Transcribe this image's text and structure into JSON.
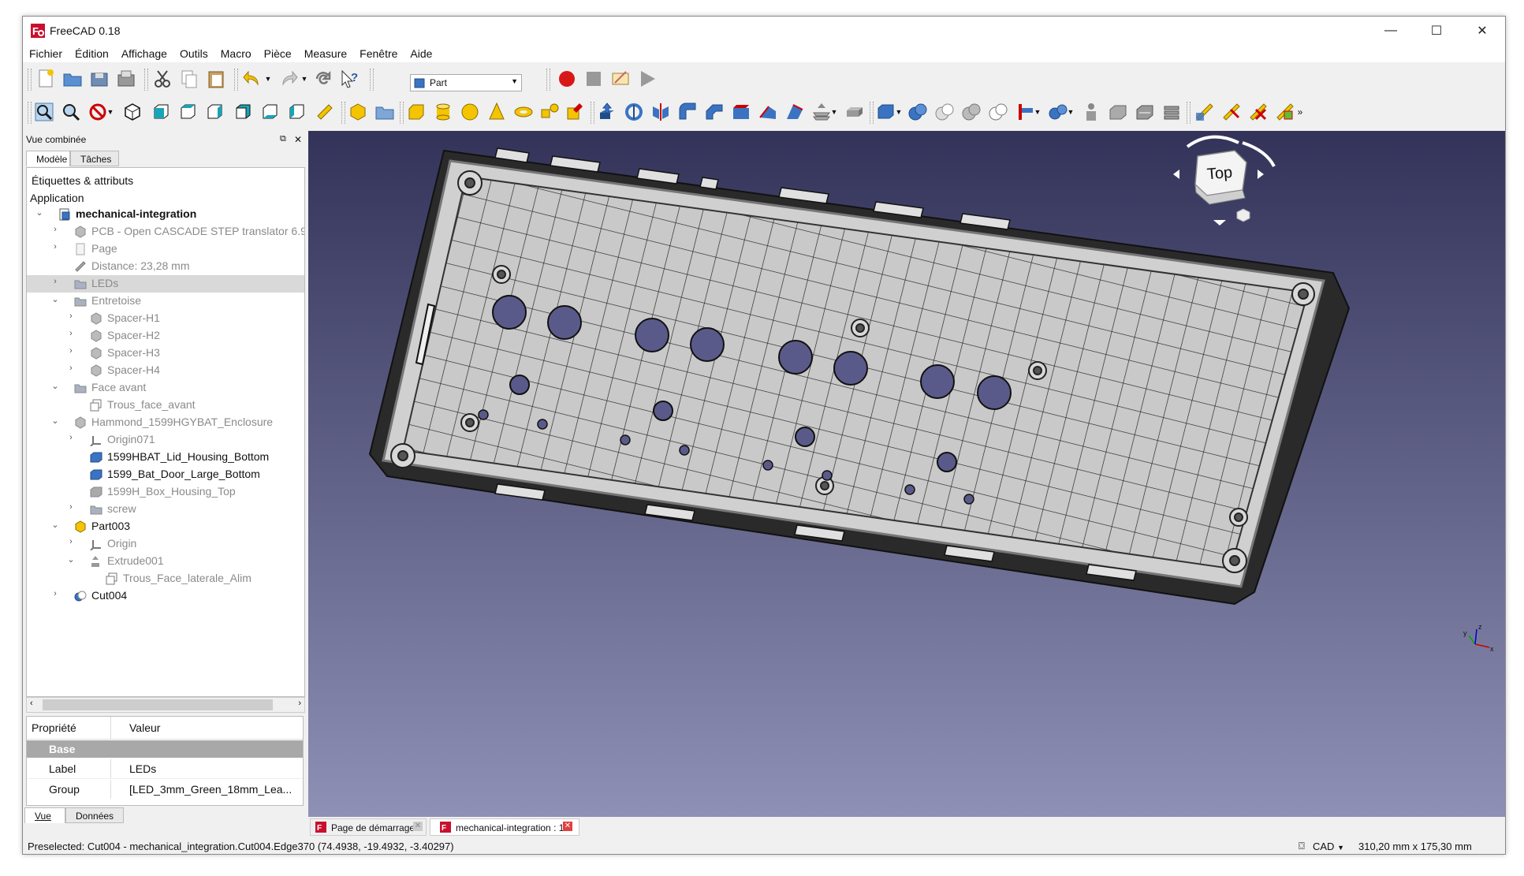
{
  "window": {
    "title": "FreeCAD 0.18",
    "controls": {
      "minimize": "—",
      "maximize": "☐",
      "close": "✕"
    }
  },
  "menu": [
    "Fichier",
    "Édition",
    "Affichage",
    "Outils",
    "Macro",
    "Pièce",
    "Measure",
    "Fenêtre",
    "Aide"
  ],
  "toolbar": {
    "workbench": "Part"
  },
  "panel": {
    "title": "Vue combinée",
    "tabs": [
      "Modèle",
      "Tâches"
    ],
    "tree_header": "Étiquettes & attributs",
    "tree": [
      {
        "label": "Application",
        "depth": -1,
        "style": "normal",
        "twisty": "",
        "icon": ""
      },
      {
        "label": "mechanical-integration",
        "depth": 0,
        "style": "bold",
        "twisty": "open",
        "icon": "document-icon"
      },
      {
        "label": "PCB - Open CASCADE STEP translator 6.9",
        "depth": 1,
        "style": "grey",
        "twisty": "closed",
        "icon": "part-icon"
      },
      {
        "label": "Page",
        "depth": 1,
        "style": "grey",
        "twisty": "closed",
        "icon": "page-icon"
      },
      {
        "label": "Distance: 23,28 mm",
        "depth": 1,
        "style": "grey",
        "twisty": "",
        "icon": "measure-icon"
      },
      {
        "label": "LEDs",
        "depth": 1,
        "style": "grey",
        "twisty": "closed",
        "icon": "folder-icon",
        "selected": true
      },
      {
        "label": "Entretoise",
        "depth": 1,
        "style": "grey",
        "twisty": "open",
        "icon": "folder-icon"
      },
      {
        "label": "Spacer-H1",
        "depth": 2,
        "style": "grey",
        "twisty": "closed",
        "icon": "part-icon"
      },
      {
        "label": "Spacer-H2",
        "depth": 2,
        "style": "grey",
        "twisty": "closed",
        "icon": "part-icon"
      },
      {
        "label": "Spacer-H3",
        "depth": 2,
        "style": "grey",
        "twisty": "closed",
        "icon": "part-icon"
      },
      {
        "label": "Spacer-H4",
        "depth": 2,
        "style": "grey",
        "twisty": "closed",
        "icon": "part-icon"
      },
      {
        "label": "Face avant",
        "depth": 1,
        "style": "grey",
        "twisty": "open",
        "icon": "folder-icon"
      },
      {
        "label": "Trous_face_avant",
        "depth": 2,
        "style": "grey",
        "twisty": "",
        "icon": "sketch-icon"
      },
      {
        "label": "Hammond_1599HGYBAT_Enclosure",
        "depth": 1,
        "style": "grey",
        "twisty": "open",
        "icon": "part-icon"
      },
      {
        "label": "Origin071",
        "depth": 2,
        "style": "grey",
        "twisty": "closed",
        "icon": "origin-icon"
      },
      {
        "label": "1599HBAT_Lid_Housing_Bottom",
        "depth": 2,
        "style": "normal",
        "twisty": "",
        "icon": "solid-icon"
      },
      {
        "label": "1599_Bat_Door_Large_Bottom",
        "depth": 2,
        "style": "normal",
        "twisty": "",
        "icon": "solid-icon"
      },
      {
        "label": "1599H_Box_Housing_Top",
        "depth": 2,
        "style": "grey",
        "twisty": "",
        "icon": "solid-grey-icon"
      },
      {
        "label": "screw",
        "depth": 2,
        "style": "grey",
        "twisty": "closed",
        "icon": "folder-icon"
      },
      {
        "label": "Part003",
        "depth": 1,
        "style": "normal",
        "twisty": "open",
        "icon": "part-yellow-icon"
      },
      {
        "label": "Origin",
        "depth": 2,
        "style": "grey",
        "twisty": "closed",
        "icon": "origin-icon"
      },
      {
        "label": "Extrude001",
        "depth": 2,
        "style": "grey",
        "twisty": "open",
        "icon": "extrude-icon"
      },
      {
        "label": "Trous_Face_laterale_Alim",
        "depth": 3,
        "style": "grey",
        "twisty": "",
        "icon": "sketch-icon"
      },
      {
        "label": "Cut004",
        "depth": 1,
        "style": "normal",
        "twisty": "closed",
        "icon": "cut-icon"
      }
    ],
    "properties": {
      "col_property": "Propriété",
      "col_value": "Valeur",
      "group": "Base",
      "rows": [
        {
          "name": "Label",
          "value": "LEDs"
        },
        {
          "name": "Group",
          "value": "[LED_3mm_Green_18mm_Lea..."
        }
      ]
    },
    "bottom_tabs": [
      "Vue",
      "Données"
    ]
  },
  "viewport": {
    "navcube_face": "Top",
    "axis_labels": [
      "x",
      "y",
      "z"
    ]
  },
  "document_tabs": [
    {
      "label": "Page de démarrage",
      "active": false
    },
    {
      "label": "mechanical-integration : 1*",
      "active": true
    }
  ],
  "statusbar": {
    "message": "Preselected: Cut004 - mechanical_integration.Cut004.Edge370 (74.4938, -19.4932, -3.40297)",
    "nav_style": "CAD",
    "dimensions": "310,20 mm x 175,30 mm"
  }
}
